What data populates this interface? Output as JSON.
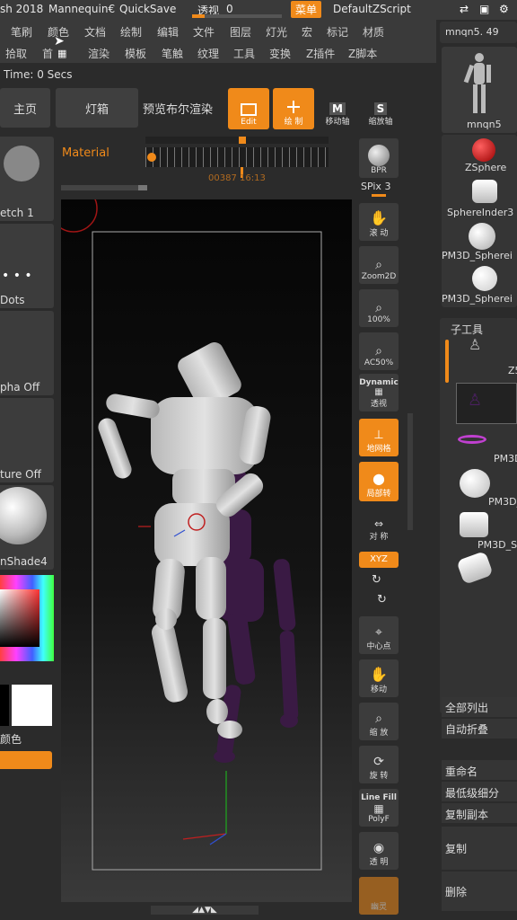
{
  "titlebar": {
    "app": "sh 2018",
    "doc": "Mannequin€",
    "quicksave": "QuickSave",
    "transparency_label": "透视",
    "transparency_value": "0",
    "menu_btn": "菜单",
    "script": "DefaultZScript"
  },
  "menus": {
    "row1": [
      "笔刷",
      "颜色",
      "文档",
      "绘制",
      "编辑",
      "文件",
      "图层",
      "灯光",
      "宏",
      "标记",
      "材质"
    ],
    "row2": [
      "拾取",
      "首",
      "渲染",
      "模板",
      "笔触",
      "纹理",
      "工具",
      "变换",
      "Z插件",
      "Z脚本"
    ]
  },
  "timebar": {
    "text": "Time: 0 Secs"
  },
  "toolbar": {
    "home": "主页",
    "lightbox": "灯箱",
    "preview": "预览布尔渲染",
    "edit": "Edit",
    "draw": "绘 制",
    "move_label": "移动轴",
    "scale_label": "缩放轴",
    "move_key": "M",
    "scale_key": "S"
  },
  "material": {
    "label": "Material",
    "timeline_text": "00387 16:13"
  },
  "left": {
    "sketch": "etch 1",
    "dots": "Dots",
    "alpha": "pha Off",
    "texture": "ture Off",
    "matcap": "nShade4",
    "color_label": "颜色"
  },
  "right_tools": {
    "bpr": "BPR",
    "spix_label": "SPix",
    "spix_value": "3",
    "scroll": "滚 动",
    "zoom2d": "Zoom2D",
    "actual": "100%",
    "ac50": "AC50%",
    "dynamic": "Dynamic",
    "persp": "透视",
    "floor": "地网格",
    "local": "局部转",
    "sym": "对 称",
    "xyz": "XYZ",
    "center": "中心点",
    "move": "移动",
    "zoom": "缩 放",
    "rotate": "旋 转",
    "linefill": "Line Fill",
    "polyf": "PolyF",
    "transp": "透 明",
    "ghost": "幽灵"
  },
  "panel": {
    "current_tool": "mnqn5. 49",
    "tool_thumb": "mnqn5",
    "tools": [
      "ZSphere",
      "SphereInder3",
      "PM3D_Spherei",
      "PM3D_Spherei"
    ],
    "subtool_title": "子工具",
    "subtool_names": [
      "Z5",
      "PM3D",
      "PM3D_S",
      "PM3D_S"
    ],
    "actions": [
      "全部列出",
      "自动折叠",
      "重命名",
      "最低级细分",
      "复制副本",
      "复制",
      "删除"
    ]
  },
  "colors": {
    "accent": "#f08a1a",
    "bg": "#2b2b2b",
    "canvas": "#050505"
  }
}
